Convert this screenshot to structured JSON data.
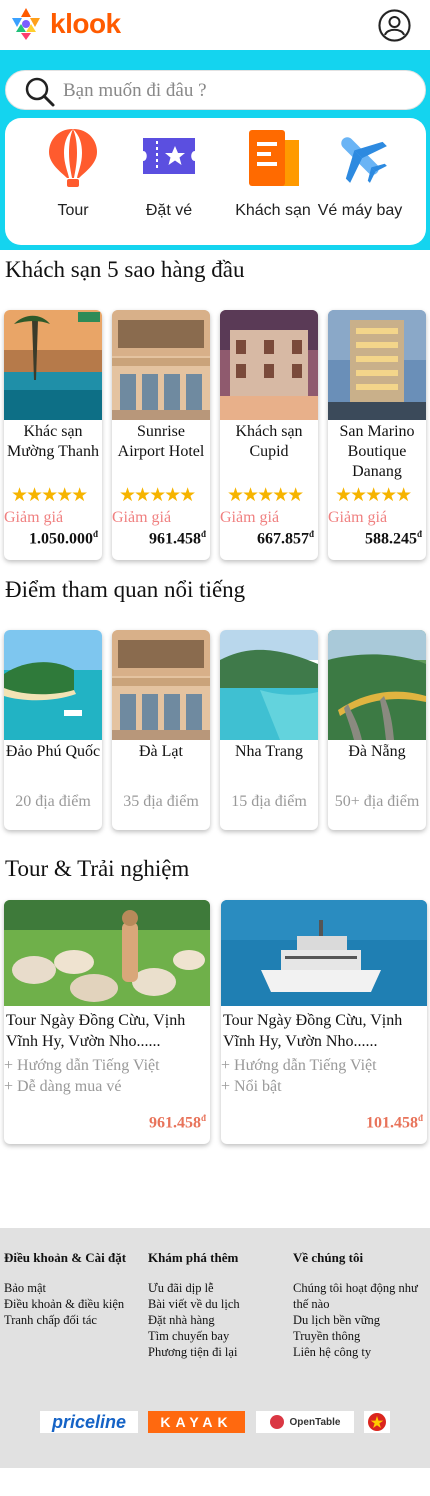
{
  "header": {
    "brand": "klook"
  },
  "search": {
    "placeholder": "Bạn muốn đi đâu ?"
  },
  "categories": [
    {
      "label": "Tour",
      "icon": "balloon-icon"
    },
    {
      "label": "Đặt vé",
      "icon": "ticket-icon"
    },
    {
      "label": "Khách sạn",
      "icon": "hotel-icon"
    },
    {
      "label": "Vé máy bay",
      "icon": "airplane-icon"
    }
  ],
  "hotels": {
    "title": "Khách sạn 5 sao hàng đầu",
    "items": [
      {
        "name": "Khác sạn Mường Thanh",
        "rating": 5,
        "discount_label": "Giảm giá",
        "price": "1.050.000",
        "currency": "đ"
      },
      {
        "name": "Sunrise Airport Hotel",
        "rating": 5,
        "discount_label": "Giảm giá",
        "price": "961.458",
        "currency": "đ"
      },
      {
        "name": "Khách sạn Cupid",
        "rating": 5,
        "discount_label": "Giảm giá",
        "price": "667.857",
        "currency": "đ"
      },
      {
        "name": "San Marino Boutique Danang",
        "rating": 5,
        "discount_label": "Giảm giá",
        "price": "588.245",
        "currency": "đ"
      }
    ]
  },
  "attractions": {
    "title": "Điểm tham quan nổi tiếng",
    "items": [
      {
        "name": "Đảo Phú Quốc",
        "count": "20 địa điểm"
      },
      {
        "name": "Đà Lạt",
        "count": "35 địa điểm"
      },
      {
        "name": "Nha Trang",
        "count": "15 địa điểm"
      },
      {
        "name": "Đà Nẵng",
        "count": "50+ địa điểm"
      }
    ]
  },
  "tours": {
    "title": "Tour & Trải nghiệm",
    "items": [
      {
        "name": "Tour Ngày Đồng Cừu, Vịnh Vĩnh Hy, Vườn Nho......",
        "features": [
          "+ Hướng dẫn Tiếng Việt",
          "+ Dễ dàng mua vé"
        ],
        "price": "961.458",
        "currency": "đ"
      },
      {
        "name": "Tour Ngày Đồng Cừu, Vịnh Vĩnh Hy, Vườn Nho......",
        "features": [
          "+ Hướng dẫn Tiếng Việt",
          "+ Nổi bật"
        ],
        "price": "101.458",
        "currency": "đ"
      }
    ]
  },
  "footer": {
    "columns": [
      {
        "heading": "Điều khoản & Cài đặt",
        "links": [
          "Bảo mật",
          "Điều khoản & điều kiện",
          "Tranh chấp đối tác"
        ]
      },
      {
        "heading": "Khám phá thêm",
        "links": [
          "Ưu đãi dịp lễ",
          "Bài viết về du lịch",
          "Đặt nhà hàng",
          "Tìm chuyến bay",
          "Phương tiện đi lại"
        ]
      },
      {
        "heading": "Về chúng tôi",
        "links": [
          "Chúng tôi hoạt động như thế nào",
          "Du lịch bền vững",
          "Truyền thông",
          "Liên hệ công ty"
        ]
      }
    ],
    "partners": [
      "priceline",
      "KAYAK",
      "OpenTable"
    ]
  },
  "colors": {
    "brand": "#ff5b00",
    "band": "#14d4ef",
    "star": "#f6b400",
    "discount": "#f08080",
    "tour_price": "#e8735a"
  }
}
